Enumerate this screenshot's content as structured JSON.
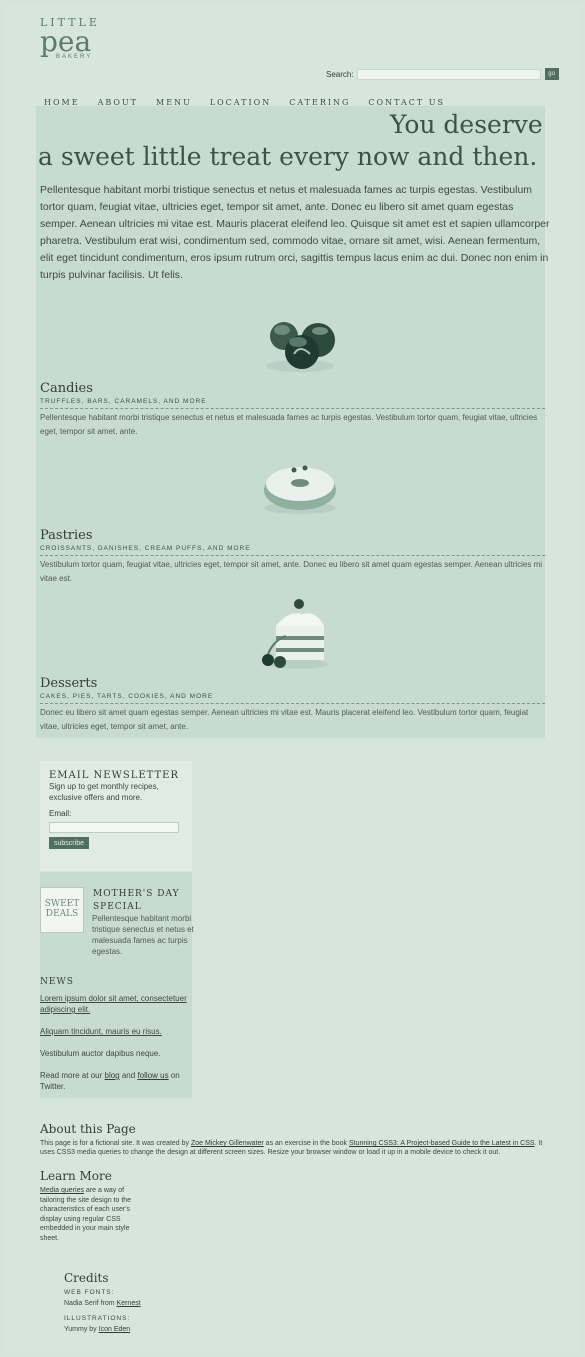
{
  "logo": {
    "line1": "LITTLE",
    "line2": "pea",
    "line3": "BAKERY"
  },
  "search": {
    "label": "Search:",
    "placeholder": "",
    "button": "go"
  },
  "nav": [
    "HOME",
    "ABOUT",
    "MENU",
    "LOCATION",
    "CATERING",
    "CONTACT US"
  ],
  "headline": {
    "part1": "You deserve",
    "part2": "a sweet little treat every now and then."
  },
  "intro": "Pellentesque habitant morbi tristique senectus et netus et malesuada fames ac turpis egestas. Vestibulum tortor quam, feugiat vitae, ultricies eget, tempor sit amet, ante. Donec eu libero sit amet quam egestas semper. Aenean ultricies mi vitae est. Mauris placerat eleifend leo. Quisque sit amet est et sapien ullamcorper pharetra. Vestibulum erat wisi, condimentum sed, commodo vitae, ornare sit amet, wisi. Aenean fermentum, elit eget tincidunt condimentum, eros ipsum rutrum orci, sagittis tempus lacus enim ac dui. Donec non enim in turpis pulvinar facilisis. Ut felis.",
  "categories": [
    {
      "title": "Candies",
      "subtitle": "TRUFFLES, BARS, CARAMELS, AND MORE",
      "text": "Pellentesque habitant morbi tristique senectus et netus et malesuada fames ac turpis egestas. Vestibulum tortor quam, feugiat vitae, ultricies eget, tempor sit amet, ante."
    },
    {
      "title": "Pastries",
      "subtitle": "CROISSANTS, DANISHES, CREAM PUFFS, AND MORE",
      "text": "Vestibulum tortor quam, feugiat vitae, ultricies eget, tempor sit amet, ante. Donec eu libero sit amet quam egestas semper. Aenean ultricies mi vitae est."
    },
    {
      "title": "Desserts",
      "subtitle": "CAKES, PIES, TARTS, COOKIES, AND MORE",
      "text": "Donec eu libero sit amet quam egestas semper. Aenean ultricies mi vitae est. Mauris placerat eleifend leo. Vestibulum tortor quam, feugiat vitae, ultricies eget, tempor sit amet, ante."
    }
  ],
  "newsletter": {
    "title": "EMAIL NEWSLETTER",
    "text": "Sign up to get monthly recipes, exclusive offers and more.",
    "email_label": "Email:",
    "button": "subscribe"
  },
  "special": {
    "badge": "SWEET DEALS",
    "title": "MOTHER'S DAY SPECIAL",
    "text": "Pellentesque habitant morbi tristique senectus et netus et malesuada fames ac turpis egestas."
  },
  "news": {
    "title": "NEWS",
    "items": [
      "Lorem ipsum dolor sit amet, consectetuer adipiscing elit.",
      "Aliquam tincidunt, mauris eu risus.",
      "Vestibulum auctor dapibus neque."
    ],
    "readmore_prefix": "Read more at our",
    "blog_link": "blog",
    "and": "and",
    "follow_link": "follow us",
    "suffix": "on Twitter."
  },
  "about": {
    "title": "About this Page",
    "text_prefix": "This page is for a fictional site. It was created by",
    "author": "Zoe Mickey Gillenwater",
    "text_mid": "as an exercise in the book",
    "book": "Stunning CSS3: A Project-based Guide to the Latest in CSS",
    "text_suffix": ". It uses CSS3 media queries to change the design at different screen sizes. Resize your browser window or load it up in a mobile device to check it out."
  },
  "learn": {
    "title": "Learn More",
    "link": "Media queries",
    "text": "are a way of tailoring the site design to the characteristics of each user's display using regular CSS embedded in your main style sheet."
  },
  "credits": {
    "title": "Credits",
    "fonts_label": "WEB FONTS:",
    "fonts_prefix": "Nadia Serif from",
    "fonts_link": "Kernest",
    "ill_label": "ILLUSTRATIONS:",
    "ill_prefix": "Yummy by",
    "ill_link": "Icon Eden"
  },
  "colors": {
    "background": "#d6e5de",
    "panel": "#c7dbd2",
    "accent": "#4f6f60"
  }
}
